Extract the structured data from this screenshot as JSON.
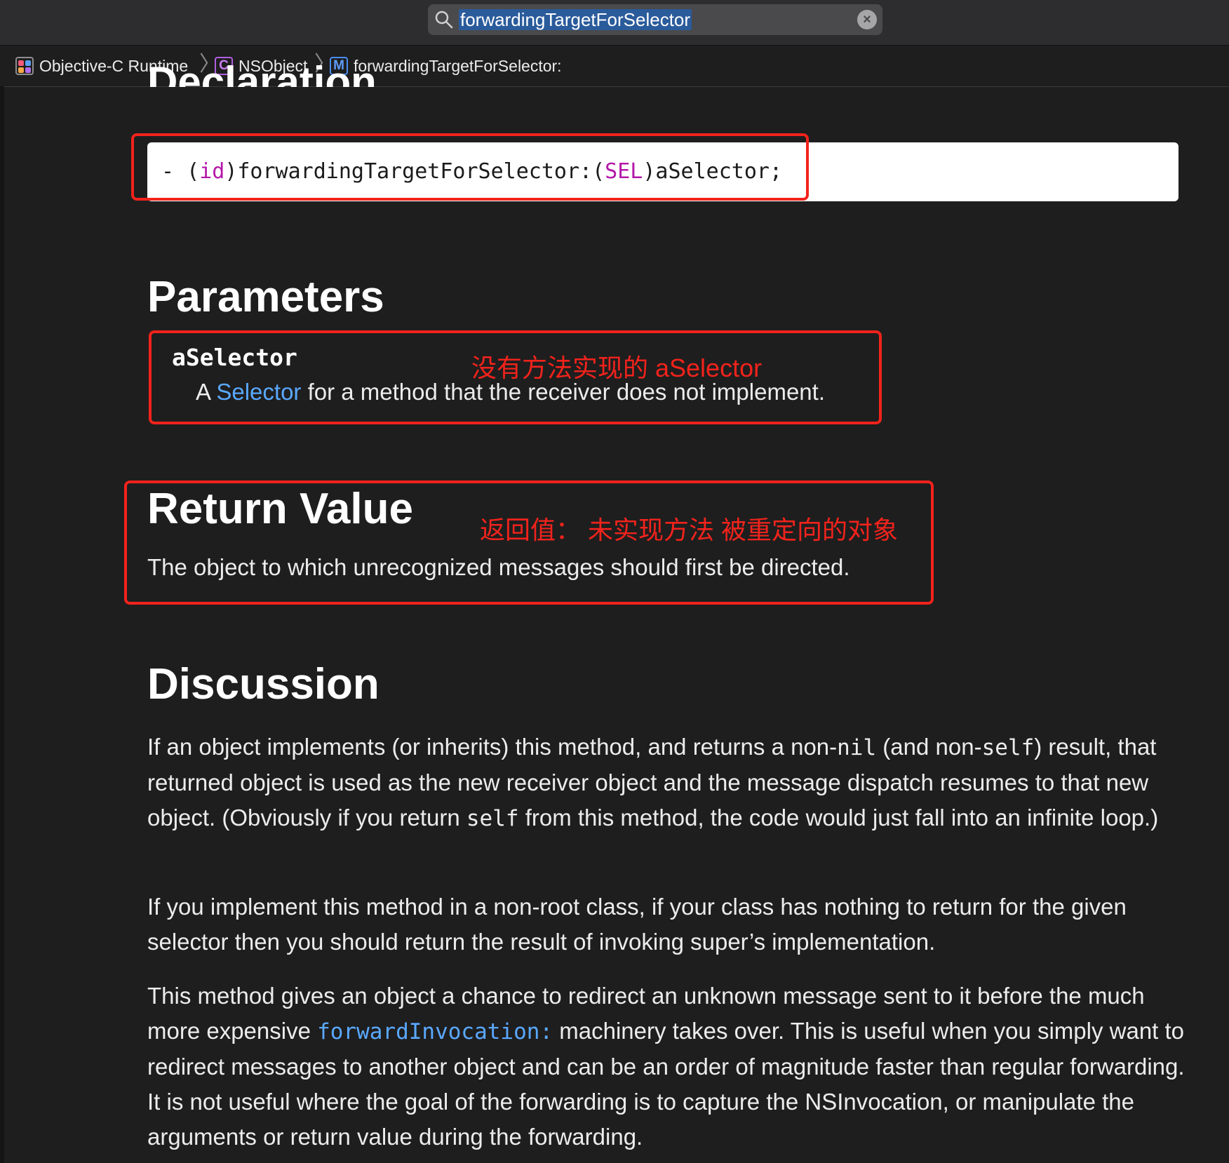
{
  "search": {
    "query": "forwardingTargetForSelector"
  },
  "breadcrumb": {
    "items": [
      {
        "label": "Objective-C Runtime",
        "badge": ""
      },
      {
        "label": "NSObject",
        "badge": "C"
      },
      {
        "label": "forwardingTargetForSelector:",
        "badge": "M"
      }
    ]
  },
  "declaration": {
    "heading": "Declaration",
    "code": {
      "prefix": "- (",
      "ret_type": "id",
      "method": ")forwardingTargetForSelector:(",
      "param_type": "SEL",
      "suffix": ")aSelector;"
    }
  },
  "parameters": {
    "heading": "Parameters",
    "name": "aSelector",
    "desc_prefix": "A ",
    "desc_link": "Selector",
    "desc_suffix": " for a method that the receiver does not implement.",
    "annotation": "没有方法实现的  aSelector"
  },
  "return_value": {
    "heading": "Return Value",
    "annotation": "返回值：  未实现方法 被重定向的对象",
    "desc": "The object to which unrecognized messages should first be directed."
  },
  "discussion": {
    "heading": "Discussion",
    "p1": {
      "t1": "If an object implements (or inherits) this method, and returns a non-",
      "c1": "nil",
      "t2": " (and non-",
      "c2": "self",
      "t3": ") result, that returned object is used as the new receiver object and the message dispatch resumes to that new object. (Obviously if you return ",
      "c3": "self",
      "t4": " from this method, the code would just fall into an infinite loop.)"
    },
    "p2": "If you implement this method in a non-root class, if your class has nothing to return for the given selector then you should return the result of invoking super’s implementation.",
    "p3": {
      "t1": "This method gives an object a chance to redirect an unknown message sent to it before the much more expensive ",
      "link": "forwardInvocation:",
      "t2": " machinery takes over. This is useful when you simply want to redirect messages to another object and can be an order of magnitude faster than regular forwarding. It is not useful where the goal of the forwarding is to capture the NSInvocation, or manipulate the arguments or return value during the forwarding."
    }
  },
  "colors": {
    "annotation_red": "#f2231c",
    "link_blue": "#5aa8ff",
    "keyword_magenta": "#b418a8",
    "background": "#1e1e1e"
  }
}
